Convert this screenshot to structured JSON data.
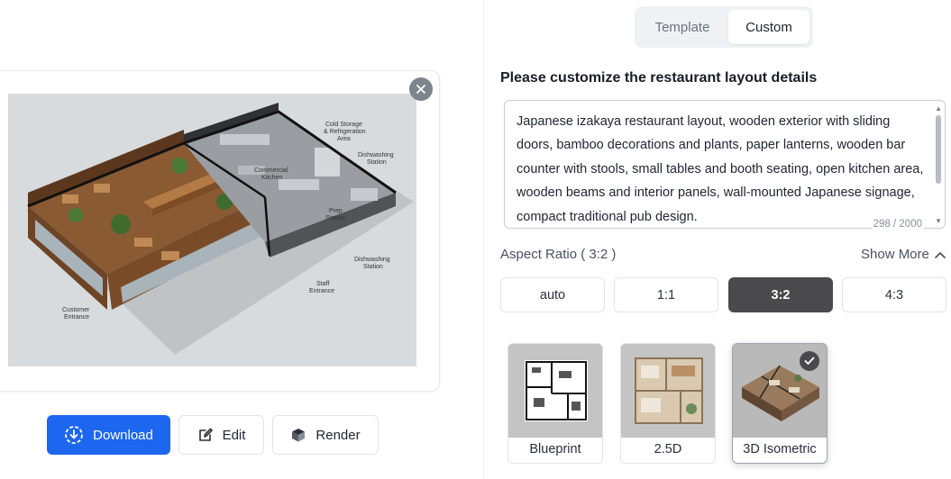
{
  "preview": {
    "labels": {
      "cold_storage": "Cold Storage & Refrigeration Area",
      "dishwashing_top": "Dishwashing Station",
      "commercial_kitchen": "Commercial Kitchen",
      "prep_station": "Prep Station",
      "dishwashing_bottom": "Dishwashing Station",
      "staff_entrance": "Staff Entrance",
      "customer_entrance": "Customer Entrance"
    }
  },
  "actions": {
    "download_label": "Download",
    "edit_label": "Edit",
    "render_label": "Render"
  },
  "mode_tabs": [
    {
      "label": "Template",
      "active": false
    },
    {
      "label": "Custom",
      "active": true
    }
  ],
  "form": {
    "title": "Please customize the restaurant layout details",
    "prompt": "Japanese izakaya restaurant layout, wooden exterior with sliding doors, bamboo decorations and plants, paper lanterns, wooden bar counter with stools, small tables and booth seating, open kitchen area, wooden beams and interior panels, wall-mounted Japanese signage, compact traditional pub design.",
    "char_count": "298 / 2000"
  },
  "aspect": {
    "label": "Aspect Ratio ( 3:2 )",
    "show_more": "Show More",
    "options": [
      "auto",
      "1:1",
      "3:2",
      "4:3"
    ],
    "selected": "3:2"
  },
  "styles": {
    "options": [
      "Blueprint",
      "2.5D",
      "3D Isometric"
    ],
    "selected": "3D Isometric"
  },
  "colors": {
    "accent": "#1d66ef",
    "selected_dark": "#4a4a4c"
  }
}
